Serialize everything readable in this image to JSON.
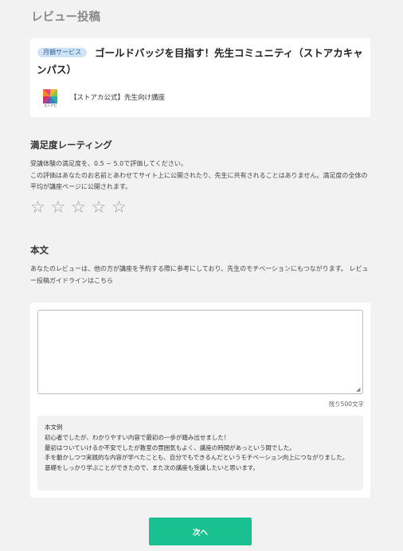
{
  "page": {
    "title": "レビュー投稿"
  },
  "course": {
    "badge": "月額サービス",
    "title": "ゴールドバッジを目指す！先生コミュニティ（ストアカキャンパス）",
    "logo_text": "ストアカ",
    "provider": "【ストアカ公式】先生向け講座"
  },
  "rating": {
    "heading": "満足度レーティング",
    "description": [
      "受講体験の満足度を、0.5 ~ 5.0で評価してください。",
      "この評価はあなたのお名前とあわせてサイト上に公開されたり、先生に共有されることはありません。満足度の全体の平均が講座ページに公開されます。"
    ],
    "star_glyph": "☆",
    "value": 0,
    "max": 5
  },
  "body": {
    "heading": "本文",
    "description": "あなたのレビューは、他の方が講座を予約する際に参考にしており、先生のモチベーションにもつながります。 レビュー投稿ガイドラインはこちら",
    "textarea_value": "",
    "remaining": "残り500文字",
    "example": [
      "本文例",
      "初心者でしたが、わかりやすい内容で最初の一歩が踏み出せました！",
      "最初はついていけるか不安でしたが教室の雰囲気もよく、講座の時間があっという間でした。",
      "手を動かしつつ実践的な内容が学べたことも、自分でもできるんだというモチベーション向上につながりました。",
      "基礎をしっかり学ぶことができたので、また次の講座も受講したいと思います。"
    ]
  },
  "actions": {
    "next_label": "次へ"
  },
  "colors": {
    "accent": "#19c191",
    "badge_bg": "#cfe3f7",
    "badge_text": "#2f5f8f"
  }
}
